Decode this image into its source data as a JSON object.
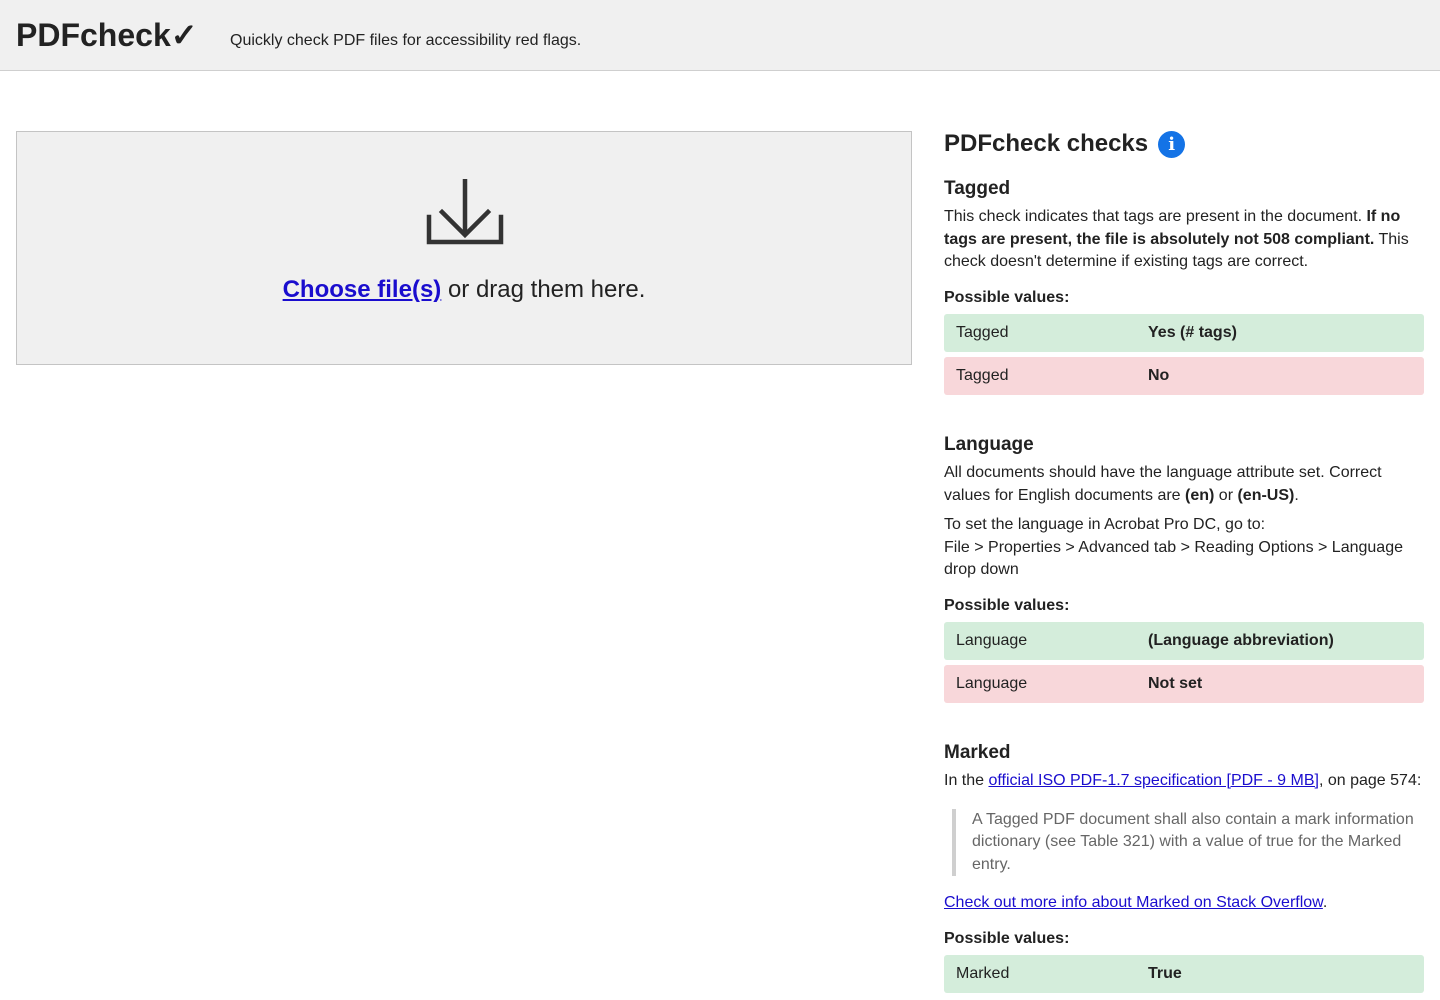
{
  "header": {
    "logo": "PDFcheck✓",
    "tagline": "Quickly check PDF files for accessibility red flags."
  },
  "dropzone": {
    "icon": "download-icon",
    "choose_link": "Choose file(s)",
    "drag_text": " or drag them here."
  },
  "checks": {
    "title": "PDFcheck checks",
    "info_icon": "i",
    "possible_label": "Possible values:",
    "tagged": {
      "heading": "Tagged",
      "desc_1": "This check indicates that tags are present in the document. ",
      "desc_bold": "If no tags are present, the file is absolutely not 508 compliant.",
      "desc_2": " This check doesn't determine if existing tags are correct.",
      "values": [
        {
          "key": "Tagged",
          "value": "Yes (# tags)",
          "status": "pass"
        },
        {
          "key": "Tagged",
          "value": "No",
          "status": "fail"
        }
      ]
    },
    "language": {
      "heading": "Language",
      "desc_1": "All documents should have the language attribute set. Correct values for English documents are ",
      "code_en": "(en)",
      "or": " or ",
      "code_en_us": "(en-US)",
      "period": ".",
      "howto_line1": "To set the language in Acrobat Pro DC, go to:",
      "howto_line2": "File > Properties > Advanced tab > Reading Options > Language drop down",
      "values": [
        {
          "key": "Language",
          "value": "(Language abbreviation)",
          "status": "pass"
        },
        {
          "key": "Language",
          "value": "Not set",
          "status": "fail"
        }
      ]
    },
    "marked": {
      "heading": "Marked",
      "intro_1": "In the ",
      "spec_link": "official ISO PDF-1.7 specification [PDF - 9 MB]",
      "intro_2": ", on page 574:",
      "quote": "A Tagged PDF document shall also contain a mark information dictionary (see Table 321) with a value of true for the Marked entry.",
      "so_link": "Check out more info about Marked on Stack Overflow",
      "so_period": ".",
      "values": [
        {
          "key": "Marked",
          "value": "True",
          "status": "pass"
        }
      ]
    }
  },
  "colors": {
    "pass_bg": "#d4eddb",
    "fail_bg": "#f8d7da",
    "link": "#1a0dce",
    "info": "#1473e6"
  }
}
